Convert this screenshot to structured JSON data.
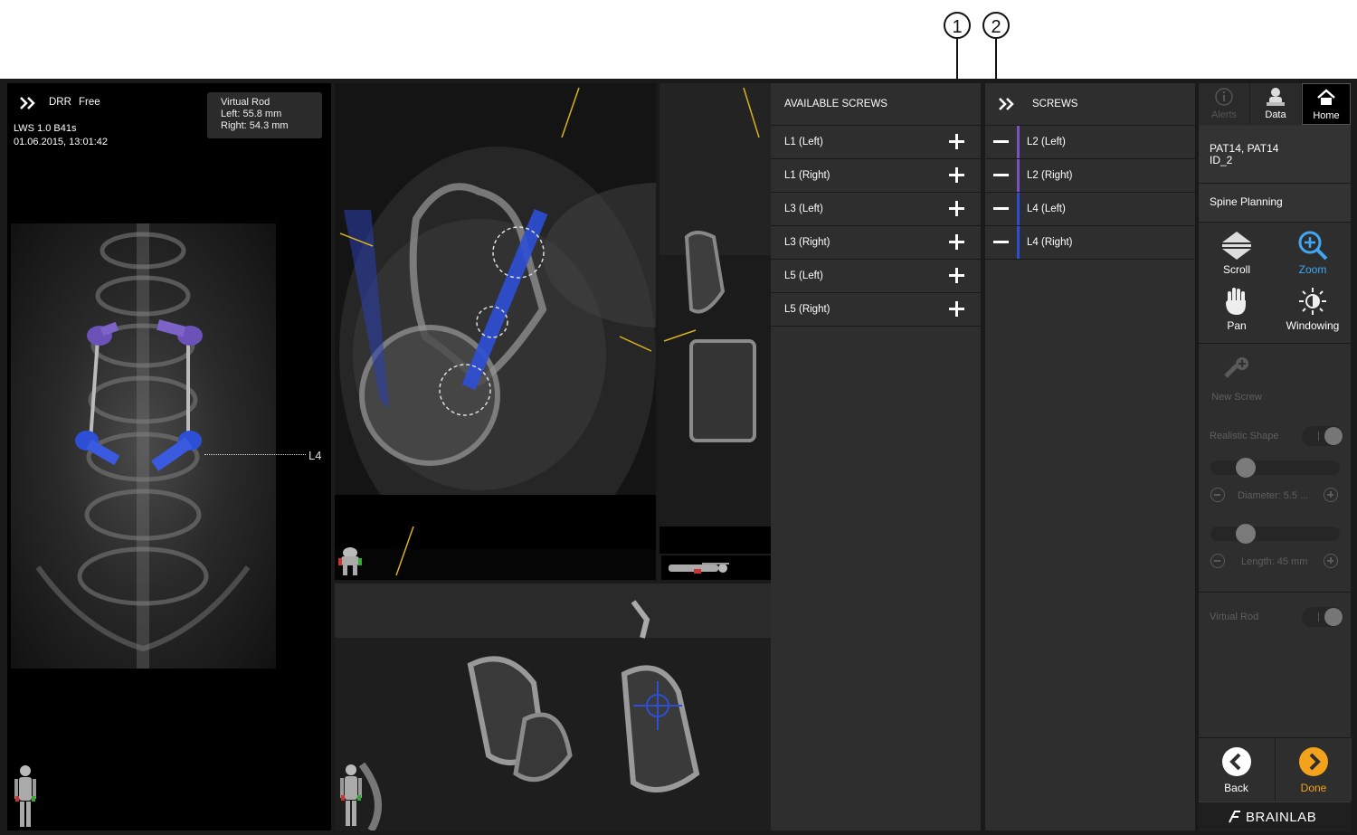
{
  "callouts": [
    "1",
    "2"
  ],
  "drr_panel": {
    "mode": "DRR",
    "state": "Free",
    "series": "LWS 1.0 B41s",
    "datetime": "01.06.2015, 13:01:42",
    "rod": {
      "title": "Virtual Rod",
      "left": "Left: 55.8 mm",
      "right": "Right: 54.3 mm"
    },
    "level_label": "L4"
  },
  "available_screws": {
    "title": "AVAILABLE SCREWS",
    "items": [
      "L1 (Left)",
      "L1 (Right)",
      "L3 (Left)",
      "L3 (Right)",
      "L5 (Left)",
      "L5 (Right)"
    ]
  },
  "screws": {
    "title": "SCREWS",
    "items": [
      {
        "label": "L2 (Left)",
        "color": "#7b52c4"
      },
      {
        "label": "L2 (Right)",
        "color": "#7b52c4"
      },
      {
        "label": "L4 (Left)",
        "color": "#2d4fd6"
      },
      {
        "label": "L4 (Right)",
        "color": "#2d4fd6"
      }
    ]
  },
  "right_panel": {
    "top_buttons": [
      "Alerts",
      "Data",
      "Home"
    ],
    "patient_name": "PAT14, PAT14",
    "patient_id": "ID_2",
    "workflow": "Spine Planning",
    "tools": [
      "Scroll",
      "Zoom",
      "Pan",
      "Windowing"
    ],
    "new_screw": "New Screw",
    "realistic_shape": "Realistic Shape",
    "diameter": "Diameter: 5.5 ...",
    "length": "Length: 45 mm",
    "virtual_rod": "Virtual Rod",
    "back": "Back",
    "done": "Done",
    "brand": "BRAINLAB"
  },
  "colors": {
    "accent_blue": "#3fa7f5",
    "done_orange": "#f2a21b",
    "screw_blue": "#2d4fd6",
    "screw_purple": "#7b52c4",
    "marker_yellow": "#d9b21b"
  }
}
